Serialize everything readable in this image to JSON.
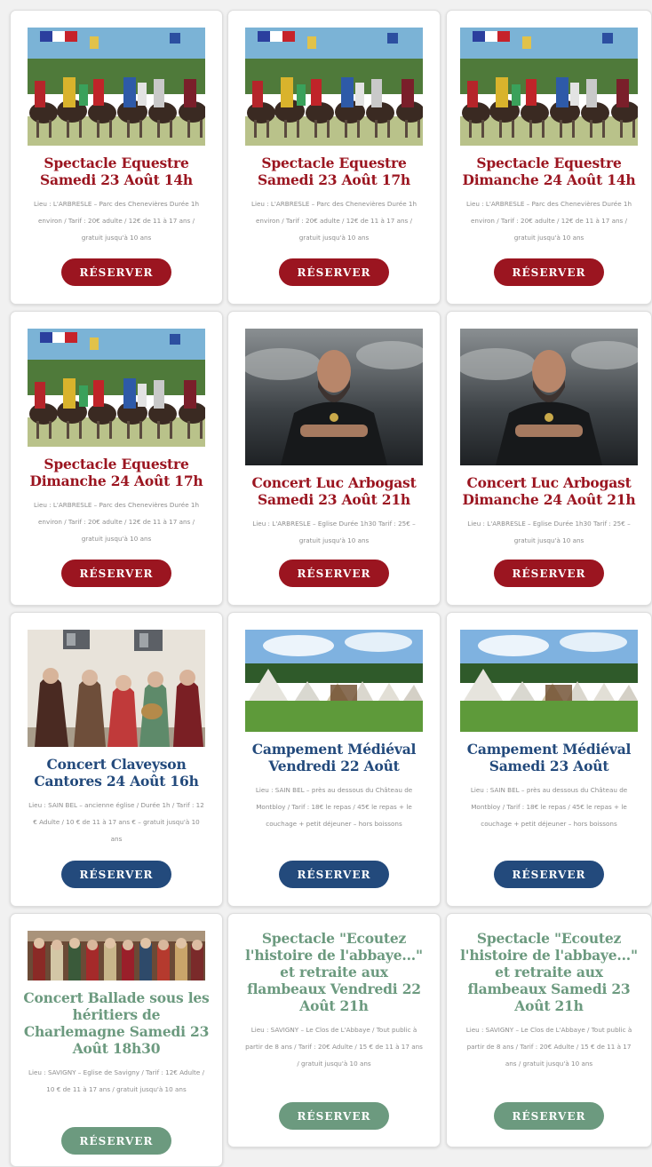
{
  "button_label": "RÉSERVER",
  "colors": {
    "red": "#9b1520",
    "blue": "#234a7c",
    "green": "#6c9a7f",
    "info_text": "#8d8d8d",
    "page_background": "#f1f1f1"
  },
  "cards": [
    {
      "title": "Spectacle Equestre Samedi 23 Août 14h",
      "info": "Lieu : L'ARBRESLE – Parc des Chenevières Durée 1h environ / Tarif : 20€ adulte / 12€ de 11 à 17 ans / gratuit jusqu'à 10 ans",
      "image": "knights-tournament-photo",
      "theme": "red"
    },
    {
      "title": "Spectacle Equestre Samedi 23 Août 17h",
      "info": "Lieu : L'ARBRESLE – Parc des Chenevières Durée 1h environ / Tarif : 20€ adulte / 12€ de 11 à 17 ans / gratuit jusqu'à 10 ans",
      "image": "knights-tournament-photo",
      "theme": "red"
    },
    {
      "title": "Spectacle Equestre Dimanche 24 Août 14h",
      "info": "Lieu : L'ARBRESLE – Parc des Chenevières Durée 1h environ / Tarif : 20€ adulte / 12€ de 11 à 17 ans / gratuit jusqu'à 10 ans",
      "image": "knights-tournament-photo",
      "theme": "red"
    },
    {
      "title": "Spectacle Equestre Dimanche 24 Août 17h",
      "info": "Lieu : L'ARBRESLE – Parc des Chenevières Durée 1h environ / Tarif : 20€ adulte / 12€ de 11 à 17 ans / gratuit jusqu'à 10 ans",
      "image": "knights-tournament-photo",
      "theme": "red"
    },
    {
      "title": "Concert Luc Arbogast Samedi 23 Août 21h",
      "info": "Lieu : L'ARBRESLE – Eglise Durée 1h30 Tarif : 25€ – gratuit jusqu'à 10 ans",
      "image": "singer-portrait-photo",
      "theme": "red"
    },
    {
      "title": "Concert Luc Arbogast Dimanche 24 Août 21h",
      "info": "Lieu : L'ARBRESLE – Eglise Durée 1h30 Tarif : 25€ – gratuit jusqu'à 10 ans",
      "image": "singer-portrait-photo",
      "theme": "red"
    },
    {
      "title": "Concert Claveyson Cantores 24 Août 16h",
      "info": "Lieu : SAIN BEL – ancienne église / Durée 1h / Tarif : 12 € Adulte / 10 € de 11 à 17 ans € – gratuit jusqu'à 10 ans",
      "image": "medieval-musicians-photo",
      "theme": "blue"
    },
    {
      "title": "Campement Médiéval Vendredi 22 Août",
      "info": "Lieu : SAIN BEL – près au dessous du Château de Montbloy / Tarif : 18€ le repas / 45€ le repas + le couchage + petit déjeuner – hors boissons",
      "image": "medieval-camp-photo",
      "theme": "blue"
    },
    {
      "title": "Campement Médiéval Samedi 23 Août",
      "info": "Lieu : SAIN BEL – près au dessous du Château de Montbloy / Tarif : 18€ le repas / 45€ le repas + le couchage + petit déjeuner – hors boissons",
      "image": "medieval-camp-photo",
      "theme": "blue"
    },
    {
      "title": "Concert Ballade sous les héritiers de Charlemagne Samedi 23 Août 18h30",
      "info": "Lieu : SAVIGNY – Eglise de Savigny / Tarif : 12€ Adulte / 10 € de 11 à 17 ans / gratuit jusqu'à 10 ans",
      "image": "costumed-performers-photo",
      "theme": "green"
    },
    {
      "title": "Spectacle \"Ecoutez l'histoire de l'abbaye...\" et retraite aux flambeaux Vendredi 22 Août 21h",
      "info": "Lieu : SAVIGNY – Le Clos de L'Abbaye / Tout public à partir de 8 ans / Tarif : 20€ Adulte / 15 € de 11 à 17 ans / gratuit jusqu'à 10 ans",
      "image": "",
      "theme": "green"
    },
    {
      "title": "Spectacle \"Ecoutez l'histoire de l'abbaye...\" et retraite aux flambeaux Samedi 23 Août 21h",
      "info": "Lieu : SAVIGNY – Le Clos de L'Abbaye / Tout public à partir de 8 ans / Tarif : 20€ Adulte / 15 € de 11 à 17 ans / gratuit jusqu'à 10 ans",
      "image": "",
      "theme": "green"
    }
  ]
}
